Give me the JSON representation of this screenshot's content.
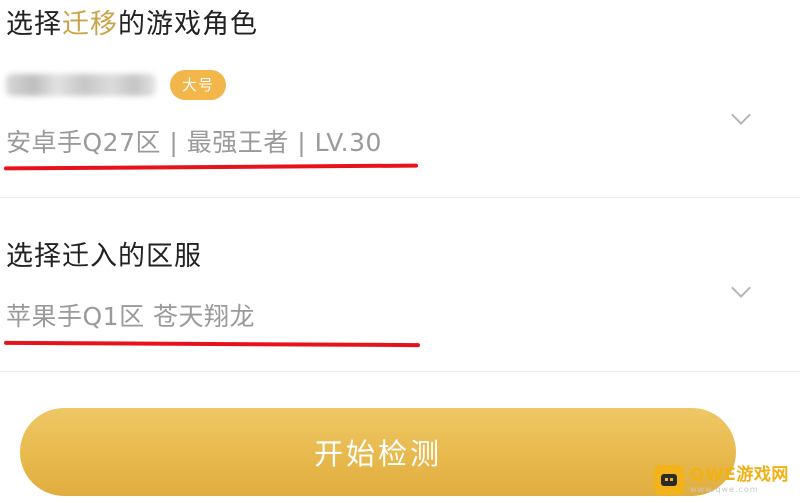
{
  "role_section": {
    "title_prefix": "选择",
    "title_highlight": "迁移",
    "title_suffix": "的游戏角色",
    "account_badge": "大号",
    "role_value": "安卓手Q27区 | 最强王者 | LV.30"
  },
  "server_section": {
    "title": "选择迁入的区服",
    "server_value": "苹果手Q1区 苍天翔龙"
  },
  "start_button": {
    "label": "开始检测"
  },
  "watermark": {
    "main_text": "QWE游戏网",
    "sub_text": "www.qwe.com"
  },
  "colors": {
    "accent": "#c9a34a",
    "button": "#e8b94d",
    "badge": "#f2b64a",
    "underline": "#e8121a",
    "muted_text": "#9a9a9a"
  },
  "icons": {
    "dropdown": "chevron-down-icon",
    "watermark_logo": "gamepad-logo-icon"
  }
}
